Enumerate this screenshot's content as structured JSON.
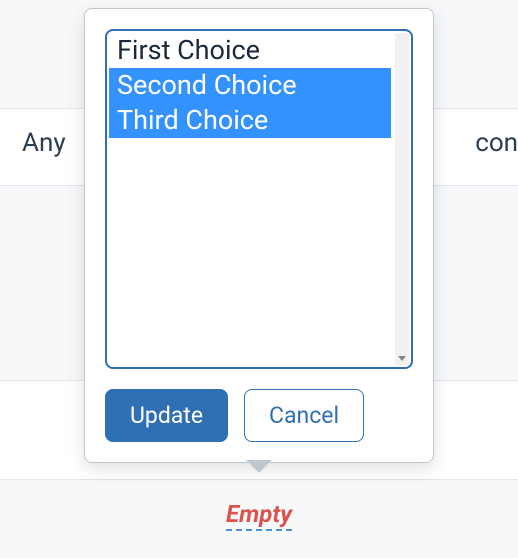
{
  "background": {
    "left_text": "Any",
    "right_text": "con"
  },
  "popover": {
    "options": [
      {
        "label": "First Choice",
        "selected": false
      },
      {
        "label": "Second Choice",
        "selected": true
      },
      {
        "label": "Third Choice",
        "selected": true
      }
    ],
    "buttons": {
      "update_label": "Update",
      "cancel_label": "Cancel"
    }
  },
  "empty_label": "Empty"
}
